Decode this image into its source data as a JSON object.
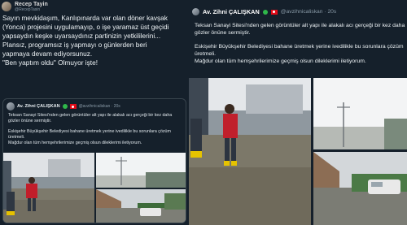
{
  "left_tweet": {
    "author_name": "Recep Tayin",
    "author_handle": "@RecepTasin",
    "text_lines": [
      "Sayın mevkidaşım, Kanlıpınarda var olan döner kavşak",
      "(Yonca) projesini uygulamayıp,  o işe yaramaz üst geçidi",
      "yapsaydın keşke uyarsaydınız partinizin yetkililerini...",
      "Plansız, programsız iş yapmayı o günlerden beri",
      "yapmaya devam ediyorsunuz.",
      "\"Ben yaptım oldu\" Olmuyor işte!"
    ],
    "quoted": {
      "author_name": "Av. Zihni ÇALIŞKAN",
      "author_handle": "@avzihnicaliskan · 20s",
      "text1": "Teksan Sanayi Sitesi'nden gelen görüntüler alt yapı ile alakalı acı gerçeği bir kez daha gözler önüne sermiştir.",
      "text2": "Eskişehir Büyükşehir Belediyesi bahane üretmek yerine ivedilikle bu sorunlara çözüm üretmeli.",
      "text3": "Mağdur olan tüm hemşehrilerimize geçmiş olsun dileklerimi iletiyorum."
    }
  },
  "right_tweet": {
    "author_name": "Av. Zihni ÇALIŞKAN",
    "author_handle": "@avzihnicaliskan · 20s",
    "text1": "Teksan Sanayi Sitesi'nden gelen görüntüler alt yapı ile alakalı acı gerçeği bir kez daha gözler önüne sermiştir.",
    "text2": "Eskişehir Büyükşehir Belediyesi bahane üretmek yerine ivedilikle bu sorunlara çözüm üretmeli.",
    "text3": "Mağdur olan tüm hemşehrilerimize geçmiş olsun dileklerimi iletiyorum."
  }
}
